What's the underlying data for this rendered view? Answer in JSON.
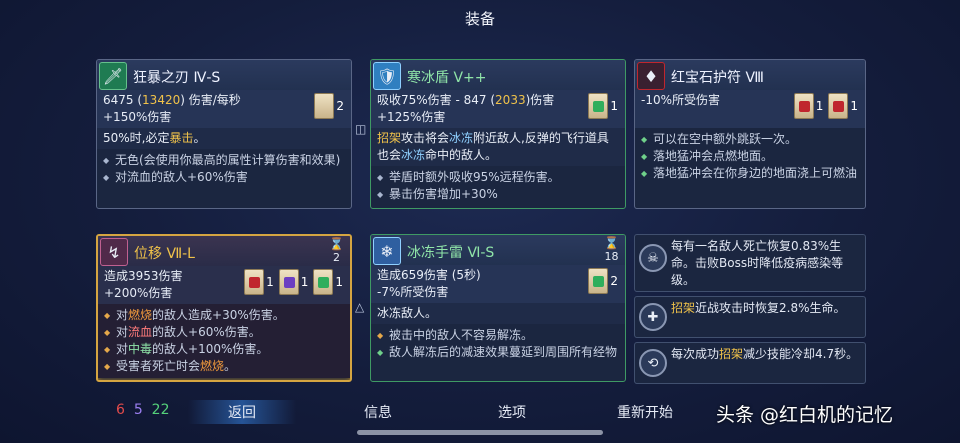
{
  "screen_title": "装备",
  "cards": {
    "c1": {
      "name": "狂暴之刃 Ⅳ-S",
      "icon": "blade-icon",
      "dps_a": "6475 (",
      "dps_b": "13420",
      "dps_c": ") 伤害/每秒",
      "bonus": "+150%伤害",
      "scroll_count": "2",
      "desc_a": "50%时,必定",
      "desc_b": "暴击",
      "desc_c": "。",
      "list": [
        "无色(会使用你最高的属性计算伤害和效果)",
        "对流血的敌人+60%伤害"
      ]
    },
    "c2": {
      "name": "寒冰盾 V++",
      "icon": "ice-shield-icon",
      "stat_a": "吸收75%伤害 - 847 (",
      "stat_b": "2033",
      "stat_c": ")伤害",
      "bonus": "+125%伤害",
      "scroll_count": "1",
      "desc_1a": "招架",
      "desc_1b": "攻击将会",
      "desc_1c": "冰冻",
      "desc_1d": "附近敌人,反弹的飞行道具也会",
      "desc_1e": "冰冻",
      "desc_1f": "命中的敌人。",
      "list": [
        "举盾时额外吸收95%远程伤害。",
        "暴击伤害增加+30%"
      ]
    },
    "c3": {
      "name": "红宝石护符 Ⅷ",
      "icon": "ruby-amulet-icon",
      "stat": "-10%所受伤害",
      "scroll_count_1": "1",
      "scroll_count_2": "1",
      "list": [
        "可以在空中额外跳跃一次。",
        "落地猛冲会点燃地面。",
        "落地猛冲会在你身边的地面浇上可燃油"
      ]
    },
    "c4": {
      "name": "位移 Ⅶ-L",
      "icon": "dash-icon",
      "uses": "2",
      "stat": "造成3953伤害",
      "bonus": "+200%伤害",
      "scroll_count_1": "1",
      "scroll_count_2": "1",
      "scroll_count_3": "1",
      "list": [
        {
          "a": "对",
          "b": "燃烧",
          "c": "的敌人造成+30%伤害。"
        },
        {
          "a": "对",
          "b": "流血",
          "c": "的敌人+60%伤害。"
        },
        {
          "a": "对",
          "b": "中毒",
          "c": "的敌人+100%伤害。"
        },
        {
          "a": "受害者死亡时会",
          "b": "燃烧",
          "c": "。"
        }
      ]
    },
    "c5": {
      "name": "冰冻手雷 Ⅵ-S",
      "icon": "ice-grenade-icon",
      "uses": "18",
      "stat": "造成659伤害 (5秒)",
      "bonus": "-7%所受伤害",
      "scroll_count": "2",
      "desc": "冰冻敌人。",
      "list": [
        "被击中的敌人不容易解冻。",
        "敌人解冻后的减速效果蔓延到周围所有经物"
      ]
    }
  },
  "perks": [
    {
      "icon": "skull-perk-icon",
      "text": "每有一名敌人死亡恢复0.83%生命。击败Boss时降低疫病感染等级。"
    },
    {
      "icon": "parry-heal-perk-icon",
      "text_a": "招架",
      "text_b": "近战攻击时恢复2.8%生命。"
    },
    {
      "icon": "parry-cooldown-perk-icon",
      "text_a": "每次成功",
      "text_b": "招架",
      "text_c": "减少技能冷却4.7秒。"
    }
  ],
  "resources": {
    "red": "6",
    "purple": "5",
    "green": "22"
  },
  "menu": {
    "back": "返回",
    "info": "信息",
    "options": "选项",
    "restart": "重新开始"
  },
  "watermark": "头条 @红白机的记忆",
  "colors": {
    "gold": "#f0c24a",
    "ice": "#8fd0ff",
    "fire": "#f09a3c",
    "selection": "#d5a541"
  }
}
